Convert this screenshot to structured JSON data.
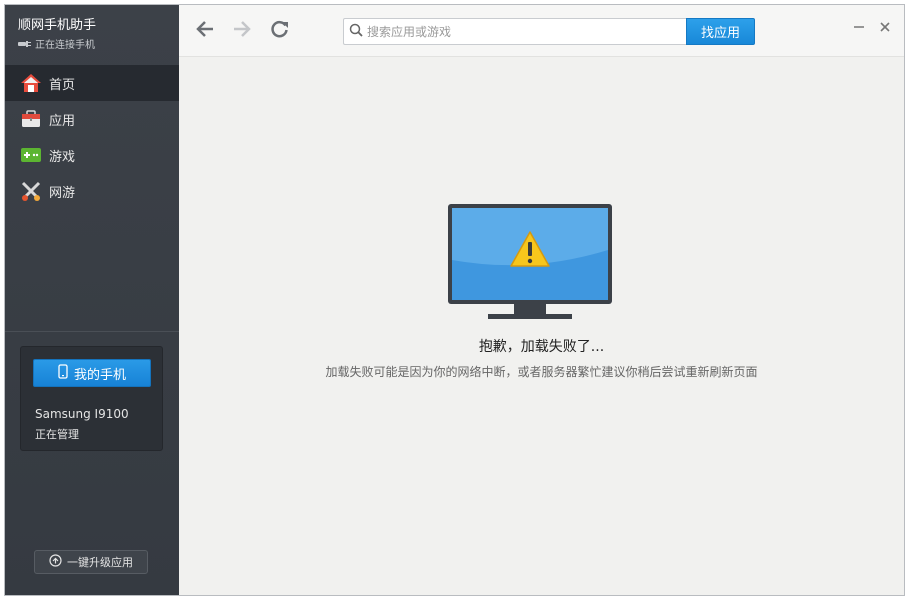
{
  "app": {
    "title": "顺网手机助手",
    "connection_status": "正在连接手机"
  },
  "sidebar": {
    "items": [
      {
        "label": "首页",
        "icon": "home-icon",
        "active": true
      },
      {
        "label": "应用",
        "icon": "briefcase-icon",
        "active": false
      },
      {
        "label": "游戏",
        "icon": "gamepad-icon",
        "active": false
      },
      {
        "label": "网游",
        "icon": "swords-icon",
        "active": false
      }
    ],
    "my_phone_button": "我的手机",
    "phone_model": "Samsung I9100",
    "phone_state": "正在管理",
    "upgrade_button": "一键升级应用"
  },
  "toolbar": {
    "search_placeholder": "搜索应用或游戏",
    "search_button": "找应用"
  },
  "error": {
    "title": "抱歉，加载失败了...",
    "description": "加载失败可能是因为你的网络中断，或者服务器繁忙建议你稍后尝试重新刷新页面"
  },
  "colors": {
    "sidebar_bg": "#3a3f46",
    "accent_blue": "#1a8ad9",
    "content_bg": "#f1f1ef",
    "warning_yellow": "#f5c21a"
  }
}
